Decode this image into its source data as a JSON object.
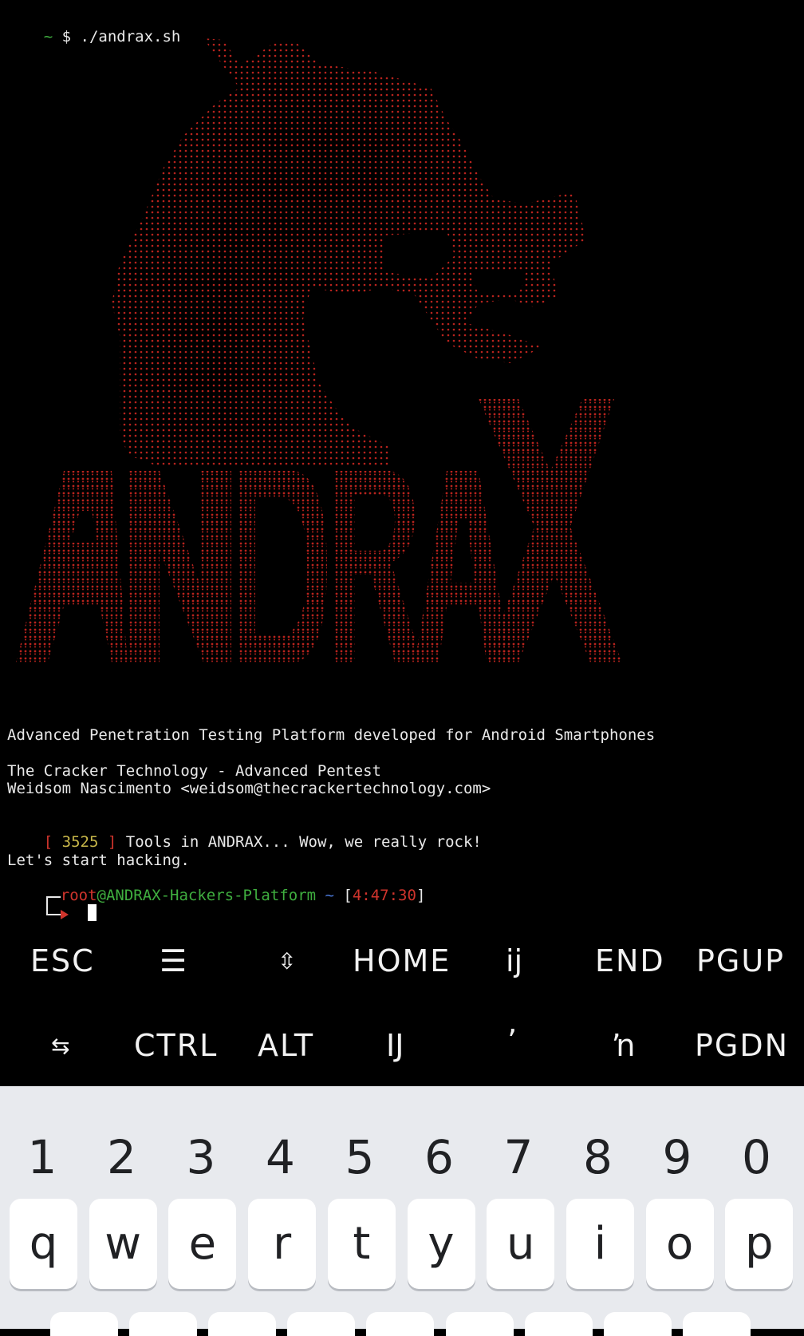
{
  "terminal": {
    "prompt_tilde": "~",
    "prompt_cmd": " $ ./andrax.sh",
    "tagline": "Advanced Penetration Testing Platform developed for Android Smartphones",
    "company": "The Cracker Technology - Advanced Pentest",
    "author": "Weidsom Nascimento <weidsom@thecrackertechnology.com>",
    "tools_open": "[ ",
    "tools_count": "3525",
    "tools_close": " ]",
    "tools_text": " Tools in ANDRAX... Wow, we really rock!",
    "start": "Let's start hacking.",
    "ps1_user": "root",
    "ps1_host": "@ANDRAX-Hackers-Platform",
    "ps1_path": " ~ ",
    "ps1_lb": "[",
    "ps1_time": "4:47:30",
    "ps1_rb": "]",
    "banner_word": "ANDRAX",
    "colors": {
      "banner": "#b8231d",
      "user": "#d0342c",
      "host": "#3fae3f",
      "path": "#4a78d8",
      "count": "#c9b84a"
    }
  },
  "extra_keys": {
    "row1": [
      "ESC",
      "☰",
      "⇳",
      "HOME",
      "ĳ",
      "END",
      "PGUP"
    ],
    "row2": [
      "⇆",
      "CTRL",
      "ALT",
      "Ĳ",
      "ʼ",
      "ŉ",
      "PGDN"
    ]
  },
  "keyboard": {
    "numbers": [
      "1",
      "2",
      "3",
      "4",
      "5",
      "6",
      "7",
      "8",
      "9",
      "0"
    ],
    "row1": [
      "q",
      "w",
      "e",
      "r",
      "t",
      "y",
      "u",
      "i",
      "o",
      "p"
    ]
  }
}
